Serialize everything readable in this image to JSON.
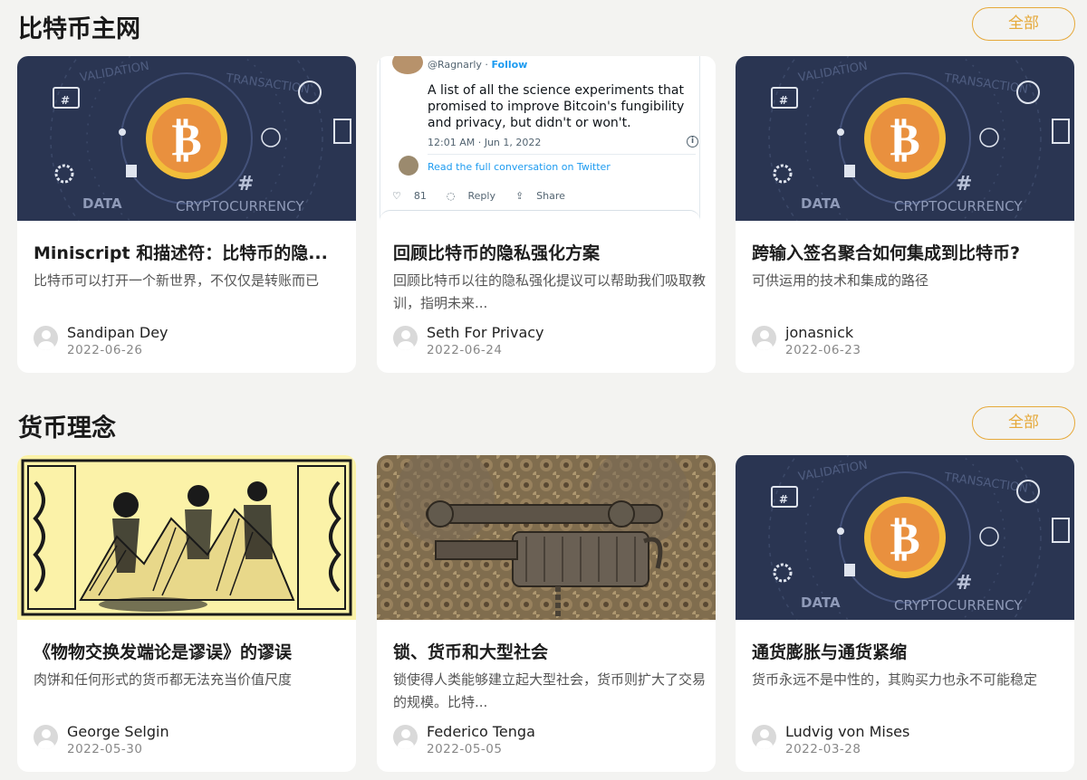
{
  "sections": [
    {
      "title": "比特币主网",
      "all_label": "全部",
      "cards": [
        {
          "title": "Miniscript 和描述符：比特币的隐...",
          "desc": "比特币可以打开一个新世界，不仅仅是转账而已",
          "author": "Sandipan Dey",
          "date": "2022-06-26",
          "thumb": "crypto-illustration"
        },
        {
          "title": "回顾比特币的隐私强化方案",
          "desc": "回顾比特币以往的隐私强化提议可以帮助我们吸取教训，指明未来...",
          "author": "Seth For Privacy",
          "date": "2022-06-24",
          "thumb": "tweet-screenshot"
        },
        {
          "title": "跨输入签名聚合如何集成到比特币?",
          "desc": "可供运用的技术和集成的路径",
          "author": "jonasnick",
          "date": "2022-06-23",
          "thumb": "crypto-illustration"
        }
      ]
    },
    {
      "title": "货币理念",
      "all_label": "全部",
      "cards": [
        {
          "title": "《物物交换发端论是谬误》的谬误",
          "desc": "肉饼和任何形式的货币都无法充当价值尺度",
          "author": "George Selgin",
          "date": "2022-05-30",
          "thumb": "woodcut-illustration"
        },
        {
          "title": "锁、货币和大型社会",
          "desc": "锁使得人类能够建立起大型社会，货币则扩大了交易的规模。比特...",
          "author": "Federico Tenga",
          "date": "2022-05-05",
          "thumb": "antique-lock-photo"
        },
        {
          "title": "通货膨胀与通货紧缩",
          "desc": "货币永远不是中性的，其购买力也永不可能稳定",
          "author": "Ludvig von Mises",
          "date": "2022-03-28",
          "thumb": "crypto-illustration"
        }
      ]
    }
  ],
  "thumb_text": {
    "crypto": {
      "validation": "VALIDATION",
      "transaction": "TRANSACTION",
      "data": "DATA",
      "cryptocurrency": "CRYPTOCURRENCY",
      "hash": "#",
      "coin": "₿"
    },
    "tweet": {
      "handle": "@Ragnarly",
      "follow": "Follow",
      "text": "A list of all the science experiments that promised to improve Bitcoin's fungibility and privacy, but didn't or won't.",
      "time": "12:01 AM · Jun 1, 2022",
      "read": "Read the full conversation on Twitter",
      "likes": "81",
      "reply": "Reply",
      "share": "Share"
    }
  },
  "colors": {
    "accent": "#e6a93a",
    "crypto_bg": "#2a3552",
    "coin": "#f0a030",
    "woodcut_bg": "#fbf2a8"
  }
}
